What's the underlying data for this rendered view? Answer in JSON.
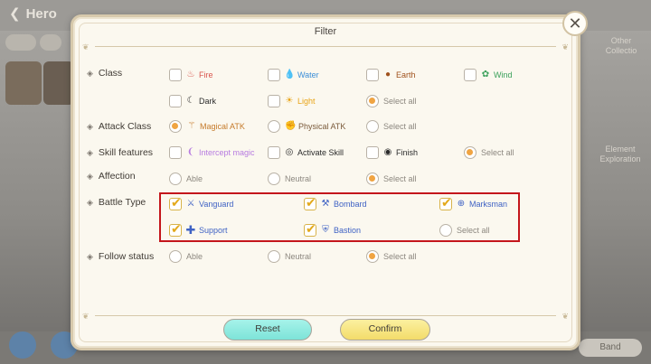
{
  "background": {
    "title": "Hero",
    "right_label_1": "Other Collectio",
    "right_label_2": "Element Exploration",
    "bottom_button": "Band"
  },
  "dialog": {
    "title": "Filter",
    "close_label": "✕",
    "rows": {
      "class": "Class",
      "attack_class": "Attack Class",
      "skill_features": "Skill features",
      "affection": "Affection",
      "battle_type": "Battle Type",
      "follow_status": "Follow status"
    },
    "class_options": {
      "fire": "Fire",
      "water": "Water",
      "earth": "Earth",
      "wind": "Wind",
      "dark": "Dark",
      "light": "Light",
      "select_all": "Select all"
    },
    "attack_class_options": {
      "magical": "Magical ATK",
      "physical": "Physical ATK",
      "select_all": "Select all"
    },
    "skill_options": {
      "intercept": "Intercept magic",
      "activate": "Activate Skill",
      "finish": "Finish",
      "select_all": "Select all"
    },
    "affection_options": {
      "able": "Able",
      "neutral": "Neutral",
      "select_all": "Select all"
    },
    "battle_type_options": {
      "vanguard": "Vanguard",
      "bombard": "Bombard",
      "marksman": "Marksman",
      "support": "Support",
      "bastion": "Bastion",
      "select_all": "Select all"
    },
    "follow_options": {
      "able": "Able",
      "neutral": "Neutral",
      "select_all": "Select all"
    },
    "reset_label": "Reset",
    "confirm_label": "Confirm"
  },
  "colors": {
    "fire": "#d9544d",
    "water": "#3c8fd8",
    "earth": "#a0521d",
    "wind": "#3aa05a",
    "dark": "#2b2b2b",
    "light": "#e8a417",
    "magical": "#c57a2a",
    "physical": "#7a5a3a",
    "intercept": "#b77be0",
    "battle": "#3f62c4",
    "selected": "#f0a442",
    "highlight": "#c4161c"
  }
}
